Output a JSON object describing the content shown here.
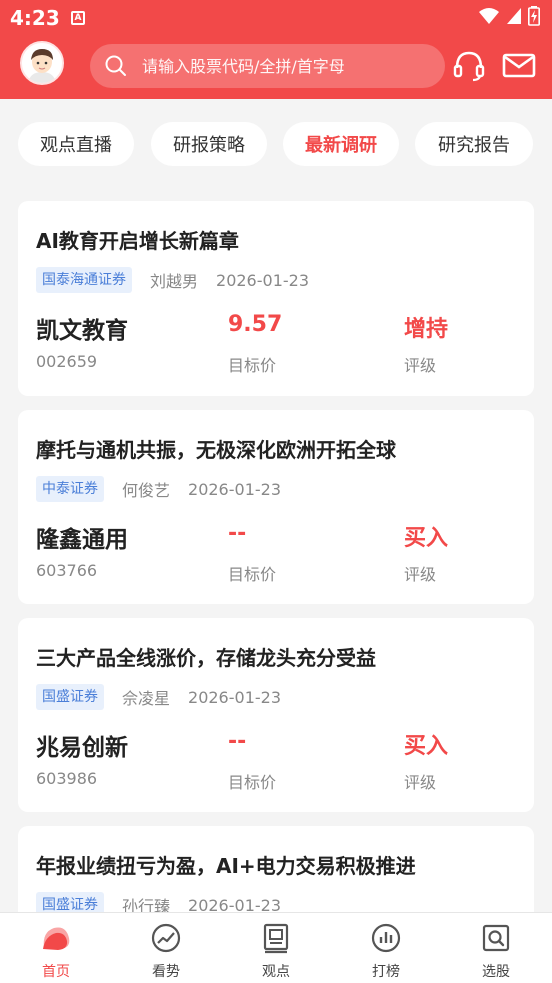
{
  "status_bar": {
    "time": "4:23",
    "badge": "A"
  },
  "header": {
    "search_placeholder": "请输入股票代码/全拼/首字母",
    "icons": [
      "avatar",
      "search-icon",
      "headset-icon",
      "mail-icon"
    ]
  },
  "tabs": [
    {
      "label": "观点直播",
      "active": false
    },
    {
      "label": "研报策略",
      "active": false
    },
    {
      "label": "最新调研",
      "active": true
    },
    {
      "label": "研究报告",
      "active": false
    }
  ],
  "labels": {
    "target_price": "目标价",
    "rating": "评级"
  },
  "cards": [
    {
      "title": "AI教育开启增长新篇章",
      "broker": "国泰海通证券",
      "analyst": "刘越男",
      "date": "2026-01-23",
      "stock_name": "凯文教育",
      "stock_code": "002659",
      "target_price": "9.57",
      "rating": "增持"
    },
    {
      "title": "摩托与通机共振，无极深化欧洲开拓全球",
      "broker": "中泰证券",
      "analyst": "何俊艺",
      "date": "2026-01-23",
      "stock_name": "隆鑫通用",
      "stock_code": "603766",
      "target_price": "--",
      "rating": "买入"
    },
    {
      "title": "三大产品全线涨价，存储龙头充分受益",
      "broker": "国盛证券",
      "analyst": "佘凌星",
      "date": "2026-01-23",
      "stock_name": "兆易创新",
      "stock_code": "603986",
      "target_price": "--",
      "rating": "买入"
    },
    {
      "title": "年报业绩扭亏为盈，AI+电力交易积极推进",
      "broker": "国盛证券",
      "analyst": "孙行臻",
      "date": "2026-01-23"
    }
  ],
  "bottom_nav": [
    {
      "label": "首页",
      "icon": "home-icon",
      "active": true
    },
    {
      "label": "看势",
      "icon": "trend-icon",
      "active": false
    },
    {
      "label": "观点",
      "icon": "viewpoint-icon",
      "active": false
    },
    {
      "label": "打榜",
      "icon": "ranking-icon",
      "active": false
    },
    {
      "label": "选股",
      "icon": "stock-picker-icon",
      "active": false
    }
  ],
  "colors": {
    "brand": "#f24949",
    "broker_bg": "#e8f0fc",
    "broker_text": "#4b7fd8"
  }
}
